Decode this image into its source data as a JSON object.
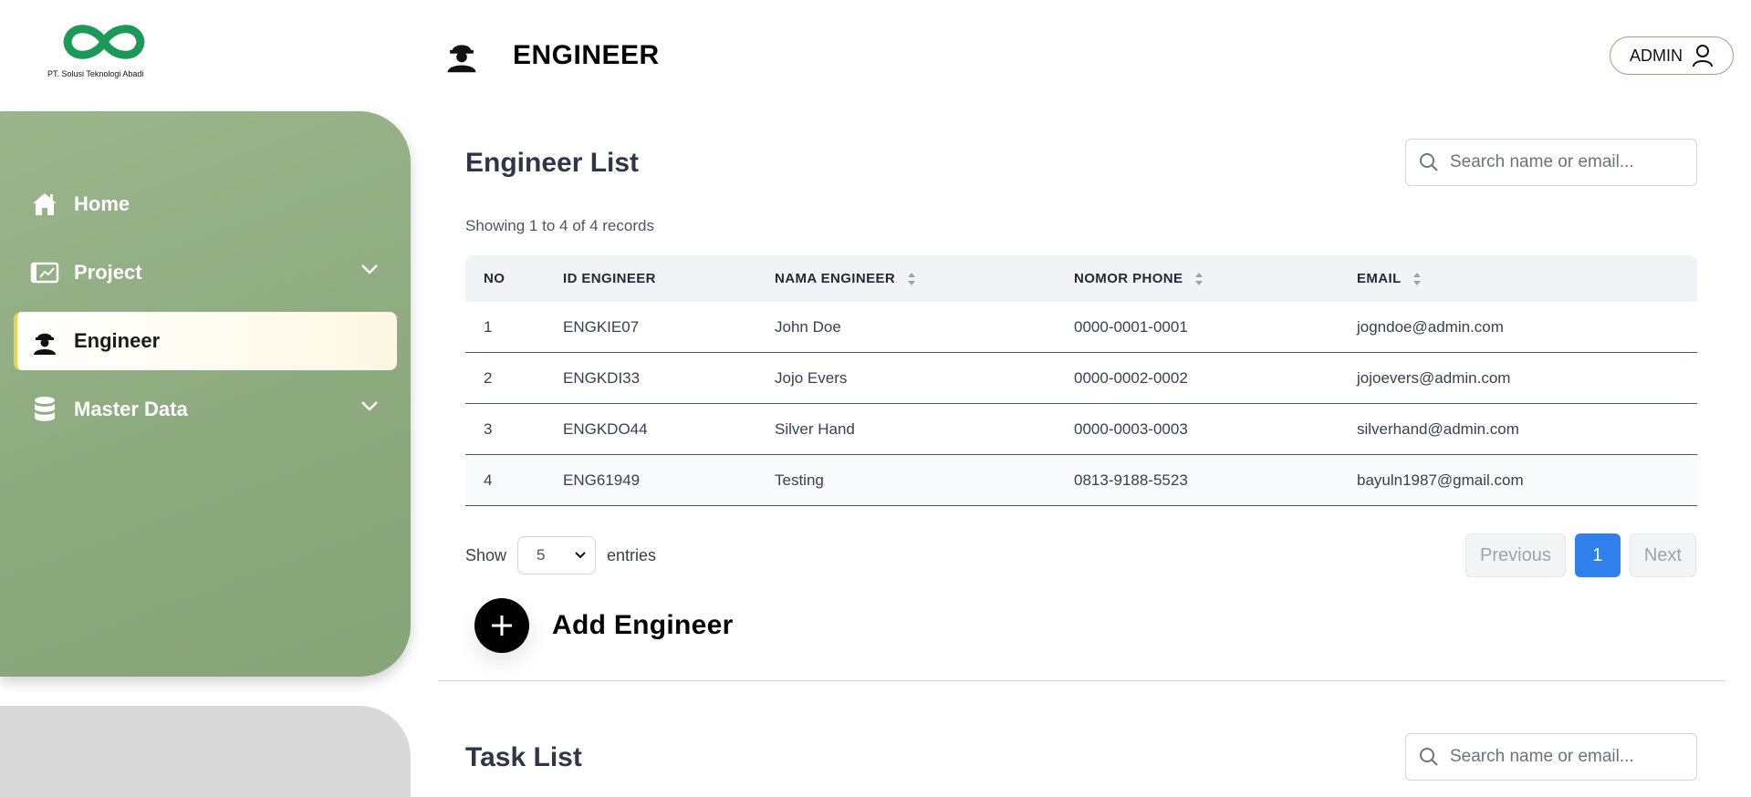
{
  "brand": {
    "company": "PT. Solusi Teknologi Abadi",
    "color": "#1a9a56"
  },
  "sidebar": {
    "bg_color": "#8fab80",
    "items": [
      {
        "label": "Home",
        "icon": "home-icon"
      },
      {
        "label": "Project",
        "icon": "blueprint-chart-icon",
        "expandable": true
      },
      {
        "label": "Engineer",
        "icon": "engineer-icon",
        "active": true
      },
      {
        "label": "Master Data",
        "icon": "database-icon",
        "expandable": true
      }
    ]
  },
  "header": {
    "title": "ENGINEER",
    "icon": "engineer-icon",
    "user_label": "ADMIN"
  },
  "engineer_section": {
    "title": "Engineer List",
    "search_placeholder": "Search name or email...",
    "records_text": "Showing 1 to 4 of 4 records",
    "columns": [
      "NO",
      "ID ENGINEER",
      "NAMA ENGINEER",
      "NOMOR PHONE",
      "EMAIL"
    ],
    "rows": [
      {
        "no": "1",
        "id": "ENGKIE07",
        "name": "John Doe",
        "phone": "0000-0001-0001",
        "email": "jogndoe@admin.com"
      },
      {
        "no": "2",
        "id": "ENGKDI33",
        "name": "Jojo Evers",
        "phone": "0000-0002-0002",
        "email": "jojoevers@admin.com"
      },
      {
        "no": "3",
        "id": "ENGKDO44",
        "name": "Silver Hand",
        "phone": "0000-0003-0003",
        "email": "silverhand@admin.com"
      },
      {
        "no": "4",
        "id": "ENG61949",
        "name": "Testing",
        "phone": "0813-9188-5523",
        "email": "bayuln1987@gmail.com"
      }
    ],
    "show_label": "Show",
    "entries_value": "5",
    "entries_label": "entries",
    "pagination": {
      "previous": "Previous",
      "current": "1",
      "next": "Next",
      "accent": "#2f80ed"
    },
    "add_label": "Add Engineer"
  },
  "task_section": {
    "title": "Task List",
    "search_placeholder": "Search name or email..."
  }
}
